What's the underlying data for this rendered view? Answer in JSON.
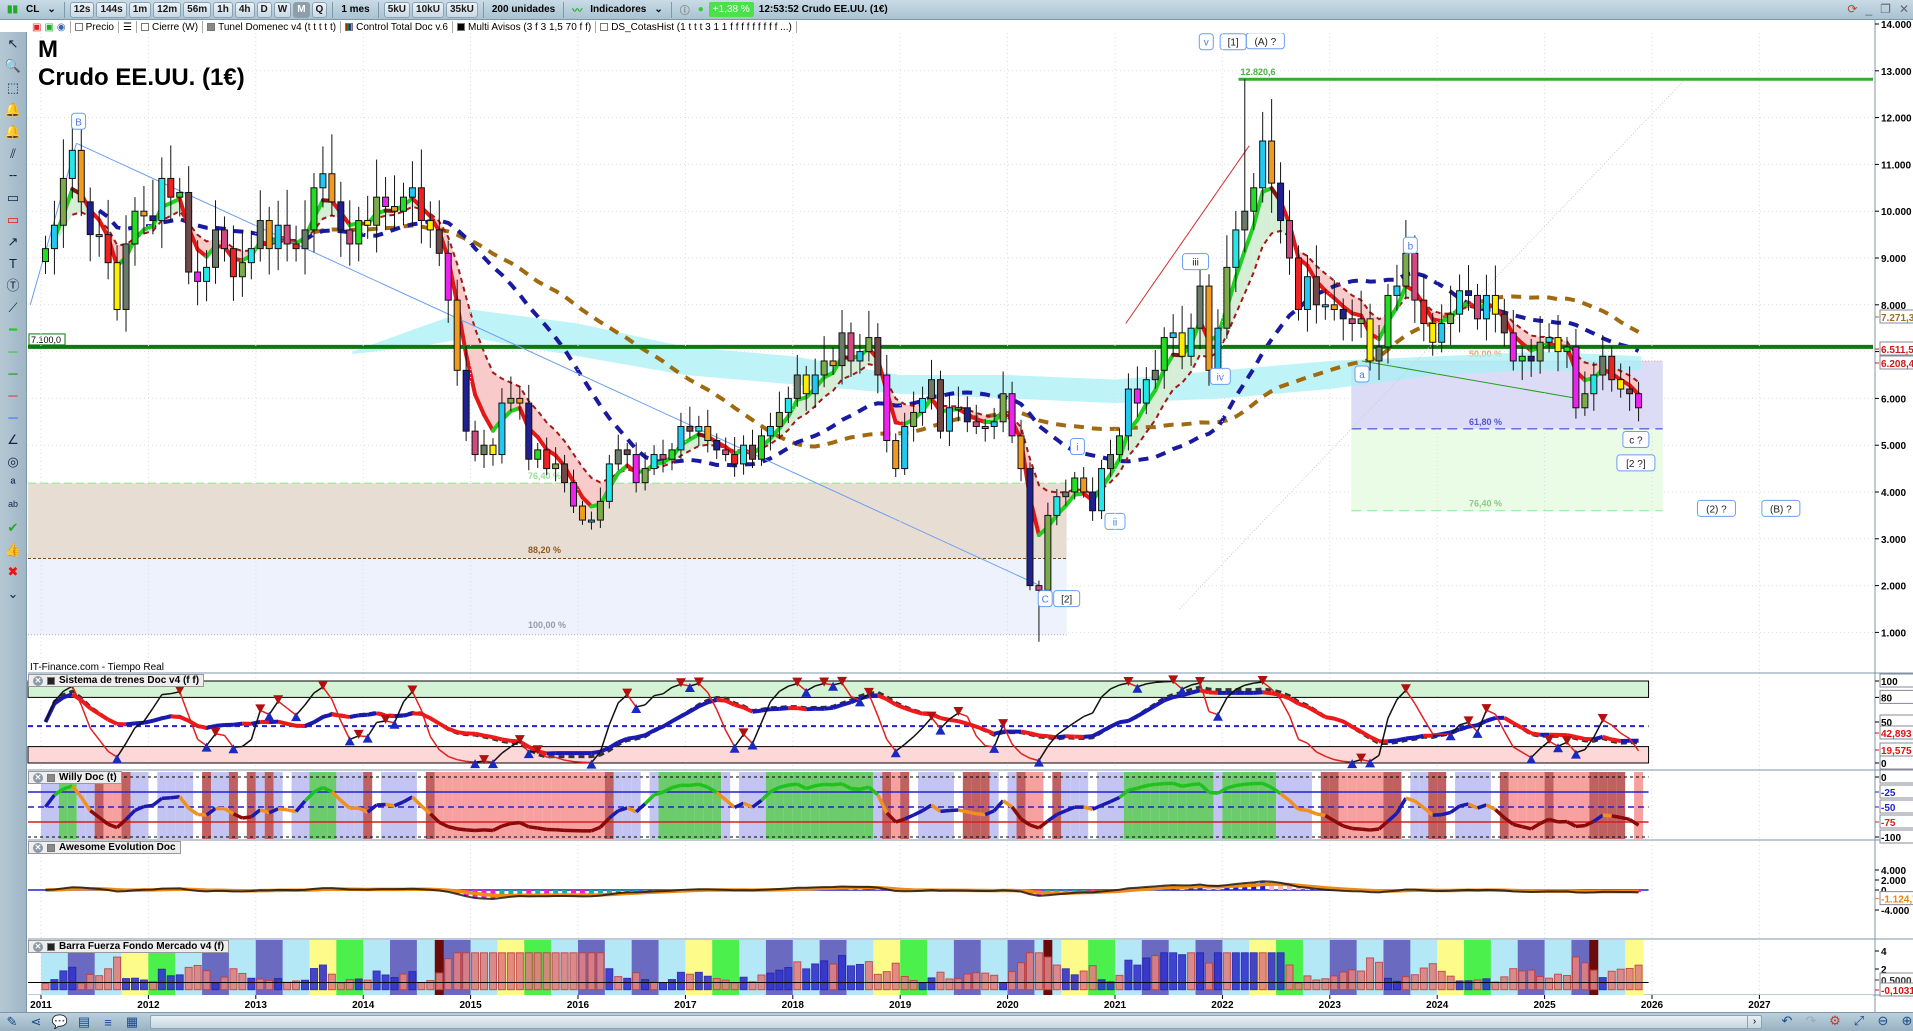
{
  "toolbar": {
    "symbol": "CL",
    "timeframes": [
      "12s",
      "144s",
      "1m",
      "12m",
      "56m",
      "1h",
      "4h",
      "D",
      "W",
      "M",
      "Q"
    ],
    "active_timeframe": "M",
    "period": "1 mes",
    "units_buttons": [
      "5kU",
      "10kU",
      "35kU"
    ],
    "units_select": "200 unidades",
    "indicators_label": "Indicadores",
    "change_pct": "+1,38 %",
    "status": "12:53:52 Crudo EE.UU. (1€)",
    "colors": {
      "up": "#4ce04c"
    }
  },
  "legend": {
    "items": [
      "Precio",
      "Cierre (W)",
      "Tunel Domenec v4 (t t t t t)",
      "Control Total Doc v.6",
      "Multi Avisos (3 f 3 1,5 70 f f)",
      "DS_CotasHist (1 t t t 3 1 1 f f f f f f f f f ...)"
    ]
  },
  "chart": {
    "timeframe_letter": "M",
    "title": "Crudo EE.UU. (1€)",
    "source": "IT-Finance.com - Tiempo Real",
    "price_ticks": [
      "14.000",
      "13.000",
      "12.000",
      "11.000",
      "10.000",
      "9.000",
      "8.000",
      "7.000",
      "6.000",
      "5.000",
      "4.000",
      "3.000",
      "2.000",
      "1.000"
    ],
    "year_ticks": [
      "2011",
      "2012",
      "2013",
      "2014",
      "2015",
      "2016",
      "2017",
      "2018",
      "2019",
      "2020",
      "2021",
      "2022",
      "2023",
      "2024",
      "2025",
      "2026",
      "2027"
    ],
    "level_support": {
      "label": "7.100,0",
      "value": 7100
    },
    "level_high": {
      "label": "12.820,6",
      "value": 12820.6
    },
    "badges": [
      {
        "text": "7.271,3",
        "color": "#a0701a"
      },
      {
        "text": "6.511,5",
        "color": "#d01818"
      },
      {
        "text": "6.208,4",
        "color": "#d01818"
      }
    ],
    "fib_old": [
      {
        "text": "76,40 %",
        "value": 4190
      },
      {
        "text": "88,20 %",
        "value": 2580
      },
      {
        "text": "100,00 %",
        "value": 950
      }
    ],
    "fib_new": [
      {
        "text": "50,00 %",
        "value": 6800
      },
      {
        "text": "61,80 %",
        "value": 5350
      },
      {
        "text": "76,40 %",
        "value": 3600
      }
    ],
    "wave_labels": [
      {
        "text": "B",
        "t": 2011.35,
        "p": 11900
      },
      {
        "text": "v",
        "t": 2021.85,
        "p": 13600
      },
      {
        "text": "[1]",
        "t": 2022.1,
        "p": 13600
      },
      {
        "text": "(A) ?",
        "t": 2022.4,
        "p": 13620
      },
      {
        "text": "iii",
        "t": 2021.75,
        "p": 8900
      },
      {
        "text": "iv",
        "t": 2021.98,
        "p": 6450
      },
      {
        "text": "a",
        "t": 2023.3,
        "p": 6500
      },
      {
        "text": "b",
        "t": 2023.75,
        "p": 9250
      },
      {
        "text": "c ?",
        "t": 2025.85,
        "p": 5100
      },
      {
        "text": "[2 ?]",
        "t": 2025.85,
        "p": 4600
      },
      {
        "text": "(2) ?",
        "t": 2026.6,
        "p": 3630
      },
      {
        "text": "(B) ?",
        "t": 2027.2,
        "p": 3630
      },
      {
        "text": "i",
        "t": 2020.65,
        "p": 4950
      },
      {
        "text": "ii",
        "t": 2021.0,
        "p": 3350
      },
      {
        "text": "C",
        "t": 2020.35,
        "p": 1700
      },
      {
        "text": "[2]",
        "t": 2020.55,
        "p": 1700
      }
    ]
  },
  "chart_data": {
    "type": "candlestick",
    "start": "2011-01",
    "frequency": "monthly",
    "closes": [
      9200,
      9700,
      10700,
      11300,
      10200,
      9500,
      9500,
      8900,
      7900,
      9300,
      10000,
      9900,
      9800,
      10700,
      10300,
      10400,
      8700,
      8500,
      8800,
      9600,
      9200,
      8600,
      8900,
      9200,
      9800,
      9200,
      9700,
      9300,
      9200,
      9600,
      10500,
      10800,
      10200,
      9600,
      9300,
      9800,
      9700,
      10300,
      10100,
      10000,
      10300,
      10500,
      9800,
      9600,
      9100,
      8100,
      6600,
      5300,
      4800,
      5000,
      4800,
      5900,
      6000,
      5900,
      4700,
      4900,
      4500,
      4600,
      4200,
      3700,
      3400,
      3400,
      3800,
      4600,
      4900,
      4800,
      4200,
      4500,
      4800,
      4700,
      4900,
      5400,
      5300,
      5400,
      5100,
      4900,
      4800,
      4600,
      5000,
      4700,
      5200,
      5400,
      5700,
      6000,
      6500,
      6100,
      6500,
      6800,
      6700,
      7400,
      6800,
      7000,
      7300,
      6500,
      5100,
      4500,
      5400,
      5700,
      6000,
      6400,
      5300,
      5800,
      5800,
      5500,
      5400,
      5400,
      5500,
      6100,
      5200,
      4500,
      2000,
      1900,
      3500,
      3900,
      4000,
      4300,
      4000,
      3600,
      4500,
      4800,
      5200,
      6200,
      5900,
      6400,
      6600,
      7300,
      7400,
      6900,
      7500,
      8400,
      6600,
      7500,
      8800,
      9600,
      10000,
      10500,
      11500,
      10600,
      9800,
      9000,
      7900,
      8600,
      8000,
      8000,
      7900,
      7700,
      7600,
      7700,
      6800,
      7100,
      8200,
      8400,
      9100,
      8100,
      7600,
      7200,
      7600,
      7800,
      8300,
      8200,
      7700,
      8200,
      7800,
      7400,
      6800,
      6900,
      6800,
      7200,
      7300,
      7000,
      7100,
      5800,
      6100,
      6500,
      6900,
      6400,
      6200,
      6100,
      5800
    ],
    "y_range": [
      0,
      14500
    ],
    "x_range": [
      "2011",
      "2027"
    ]
  },
  "panels": [
    {
      "name": "Sistema de trenes Doc v4 (f f)",
      "ticks": [
        "100",
        "80",
        "50",
        "0"
      ],
      "badges": [
        {
          "text": "42,893",
          "color": "#e01010"
        },
        {
          "text": "19,575",
          "color": "#e01010"
        }
      ]
    },
    {
      "name": "Willy Doc (t)",
      "ticks": [
        "0",
        "-25",
        "-50",
        "-75",
        "-100"
      ],
      "badges": [
        {
          "text": "73",
          "color": "#a01010"
        }
      ]
    },
    {
      "name": "Awesome Evolution Doc",
      "ticks": [
        "4.000",
        "2.000",
        "0",
        "-4.000"
      ],
      "badges": [
        {
          "text": "-1.124,7",
          "color": "#f08010"
        }
      ]
    },
    {
      "name": "Barra Fuerza Fondo Mercado v4 (f)",
      "ticks": [
        "4",
        "2"
      ],
      "badges": [
        {
          "text": "0,5000",
          "color": "#333"
        },
        {
          "text": "-0,1031",
          "color": "#e01010"
        }
      ]
    }
  ]
}
